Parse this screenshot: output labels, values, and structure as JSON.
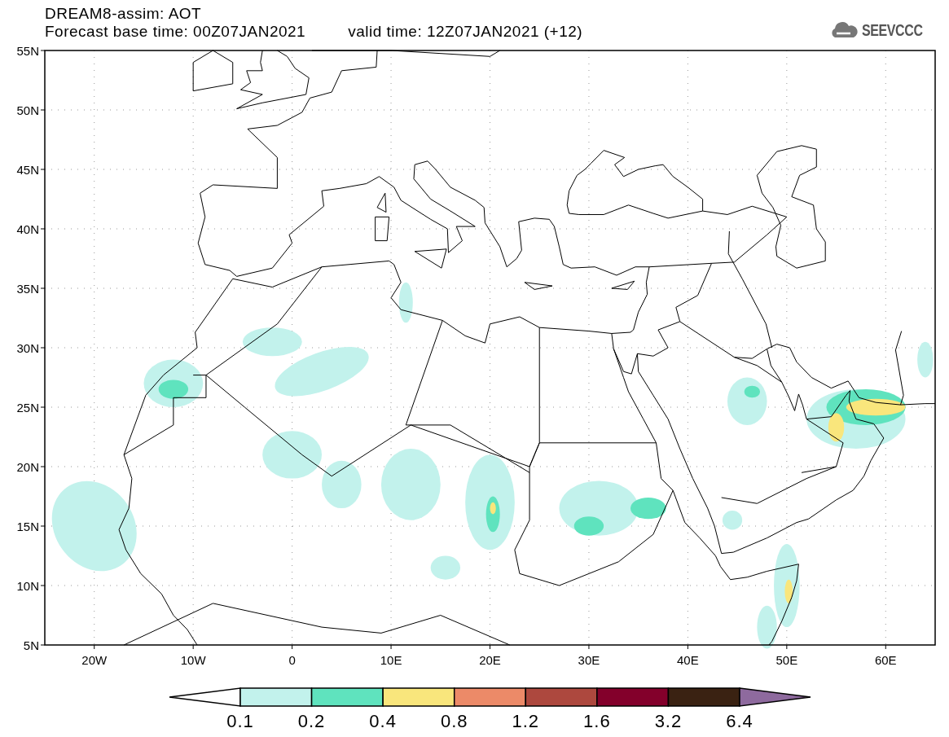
{
  "title": "DREAM8-assim: AOT",
  "base_time": "Forecast base time: 00Z07JAN2021",
  "valid_time": "valid time: 12Z07JAN2021 (+12)",
  "logo": {
    "text": "SEEVCCC"
  },
  "map": {
    "latitude_labels": [
      "55N",
      "50N",
      "45N",
      "40N",
      "35N",
      "30N",
      "25N",
      "20N",
      "15N",
      "10N",
      "5N"
    ],
    "longitude_labels": [
      "20W",
      "10W",
      "0",
      "10E",
      "20E",
      "30E",
      "40E",
      "50E",
      "60E"
    ]
  },
  "color_bar": {
    "under": {
      "color": "#ffffff"
    },
    "over": {
      "color": "#8e6a9e"
    },
    "segments": [
      {
        "color": "#c2f2ec"
      },
      {
        "color": "#5fe3be"
      },
      {
        "color": "#f9e67c"
      },
      {
        "color": "#ec8a68"
      },
      {
        "color": "#ad483e"
      },
      {
        "color": "#83002b"
      },
      {
        "color": "#3a2212"
      }
    ],
    "labels": [
      "0.1",
      "0.2",
      "0.4",
      "0.8",
      "1.2",
      "1.6",
      "3.2",
      "6.4"
    ]
  }
}
